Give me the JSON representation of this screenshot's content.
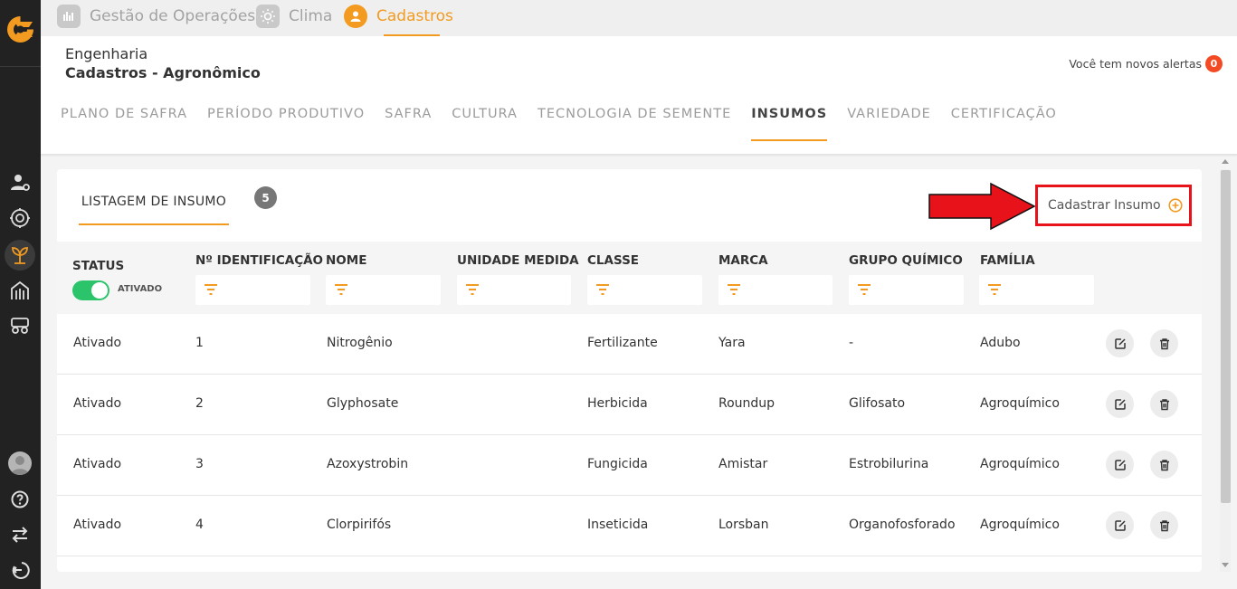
{
  "top_tabs": [
    {
      "label": "Gestão de Operações",
      "icon": "operations-icon"
    },
    {
      "label": "Clima",
      "icon": "sun-icon"
    },
    {
      "label": "Cadastros",
      "icon": "user-icon",
      "active": true
    }
  ],
  "header": {
    "breadcrumb_parent": "Engenharia",
    "breadcrumb_title": "Cadastros - Agronômico",
    "alerts_text": "Você tem novos alertas",
    "alerts_count": "0"
  },
  "subnav": [
    "PLANO DE SAFRA",
    "PERÍODO PRODUTIVO",
    "SAFRA",
    "CULTURA",
    "TECNOLOGIA DE SEMENTE",
    "INSUMOS",
    "VARIEDADE",
    "CERTIFICAÇÃO"
  ],
  "subnav_active": "INSUMOS",
  "card": {
    "tab_label": "LISTAGEM DE INSUMO",
    "count": "5",
    "register_label": "Cadastrar Insumo"
  },
  "table": {
    "columns": [
      "STATUS",
      "Nº IDENTIFICAÇÃO",
      "NOME",
      "UNIDADE MEDIDA",
      "CLASSE",
      "MARCA",
      "GRUPO QUÍMICO",
      "FAMÍLIA"
    ],
    "status_filter_label": "ATIVADO",
    "rows": [
      {
        "status": "Ativado",
        "id": "1",
        "nome": "Nitrogênio",
        "unidade": "",
        "classe": "Fertilizante",
        "marca": "Yara",
        "grupo": "-",
        "familia": "Adubo"
      },
      {
        "status": "Ativado",
        "id": "2",
        "nome": "Glyphosate",
        "unidade": "",
        "classe": "Herbicida",
        "marca": "Roundup",
        "grupo": "Glifosato",
        "familia": "Agroquímico"
      },
      {
        "status": "Ativado",
        "id": "3",
        "nome": "Azoxystrobin",
        "unidade": "",
        "classe": "Fungicida",
        "marca": "Amistar",
        "grupo": "Estrobilurina",
        "familia": "Agroquímico"
      },
      {
        "status": "Ativado",
        "id": "4",
        "nome": "Clorpirifós",
        "unidade": "",
        "classe": "Inseticida",
        "marca": "Lorsban",
        "grupo": "Organofosforado",
        "familia": "Agroquímico"
      }
    ]
  },
  "colors": {
    "accent": "#f29b20",
    "rail": "#222222",
    "toggle_on": "#2bc46a",
    "highlight_box": "#e8121a",
    "alert_badge": "#f44a23"
  }
}
